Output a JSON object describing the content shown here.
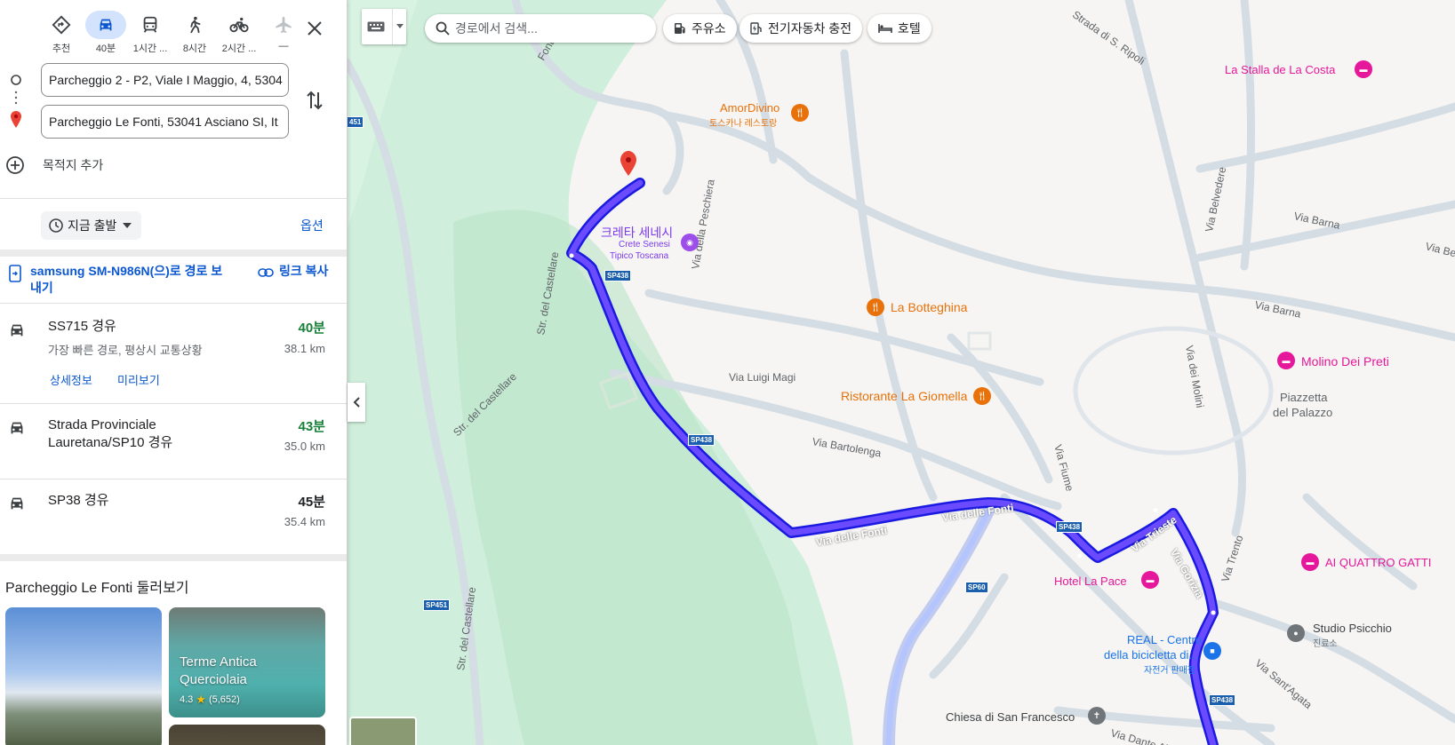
{
  "panel": {
    "modes": [
      {
        "label": "추천",
        "icon": "directions-icon"
      },
      {
        "label": "40분",
        "icon": "car-icon",
        "active": true
      },
      {
        "label": "1시간 ...",
        "icon": "transit-icon"
      },
      {
        "label": "8시간",
        "icon": "walk-icon"
      },
      {
        "label": "2시간 ...",
        "icon": "bicycle-icon"
      },
      {
        "label": "—",
        "icon": "flight-icon"
      }
    ],
    "origin": "Parcheggio 2 - P2, Viale I Maggio, 4, 5304",
    "destination": "Parcheggio Le Fonti, 53041 Asciano SI, It",
    "add_destination": "목적지 추가",
    "depart_now": "지금 출발",
    "options": "옵션",
    "send_to_device": "samsung SM-N986N(으)로 경로 보내기",
    "copy_link": "링크 복사",
    "routes": [
      {
        "name": "SS715 경유",
        "time": "40분",
        "distance": "38.1 km",
        "desc": "가장 빠른 경로, 평상시 교통상황",
        "details": "상세정보",
        "preview": "미리보기",
        "time_color": "#188038"
      },
      {
        "name": "Strada Provinciale Lauretana/SP10 경유",
        "time": "43분",
        "distance": "35.0 km",
        "time_color": "#188038"
      },
      {
        "name": "SP38 경유",
        "time": "45분",
        "distance": "35.4 km",
        "time_color": "#202124"
      }
    ],
    "explore_title": "Parcheggio Le Fonti 둘러보기",
    "cards": [
      {
        "title": "Terme Antica Querciolaia",
        "rating": "4.3",
        "reviews": "(5,652)"
      }
    ]
  },
  "map": {
    "search_placeholder": "경로에서 검색...",
    "chips": [
      "주유소",
      "전기자동차 충전",
      "호텔"
    ],
    "pois": {
      "stalla": "La Stalla de La Costa",
      "amordivino": "AmorDivino",
      "amordivino_sub": "토스카나 레스토랑",
      "crete": "크레타 세네시",
      "crete_sub1": "Crete Senesi",
      "crete_sub2": "Tipico Toscana",
      "botteghina": "La Botteghina",
      "giomella": "Ristorante La Giomella",
      "molino": "Molino Dei Preti",
      "piazzetta1": "Piazzetta",
      "piazzetta2": "del Palazzo",
      "quattro": "AI QUATTRO GATTI",
      "hotel_pace": "Hotel La Pace",
      "real1": "REAL - Centro",
      "real2": "della bicicletta di...",
      "real_sub": "자전거 판매점",
      "studio": "Studio Psicchio",
      "studio_sub": "진료소",
      "chiesa": "Chiesa di San Francesco"
    },
    "streets": {
      "ripoli": "Strada di S. Ripoli",
      "fonti_top": "Fonti",
      "peschiera": "Via della Peschiera",
      "belvedere": "Via Belvedere",
      "barna1": "Via Barna",
      "barna2": "Via Barna",
      "via_be": "Via Be",
      "castellare1": "Str. del Castellare",
      "castellare2": "Str. del Castellare",
      "castellare3": "Str. del Castellare",
      "luigi": "Via Luigi Magi",
      "molini": "Via dei Molini",
      "bartolenga": "Via Bartolenga",
      "fiume": "Via Fiume",
      "fonti1": "Via delle Fonti",
      "fonti2": "Via delle Fonti",
      "trieste": "Via Trieste",
      "gorizia": "Via Gorizia",
      "trento": "Via Trento",
      "agata": "Via Sant'Agata",
      "dante": "Via Dante Alighi"
    },
    "shields": {
      "s451a": "451",
      "s438a": "SP438",
      "s438b": "SP438",
      "s438c": "SP438",
      "s438d": "SP438",
      "sp60": "SP60",
      "sp451": "SP451"
    }
  }
}
